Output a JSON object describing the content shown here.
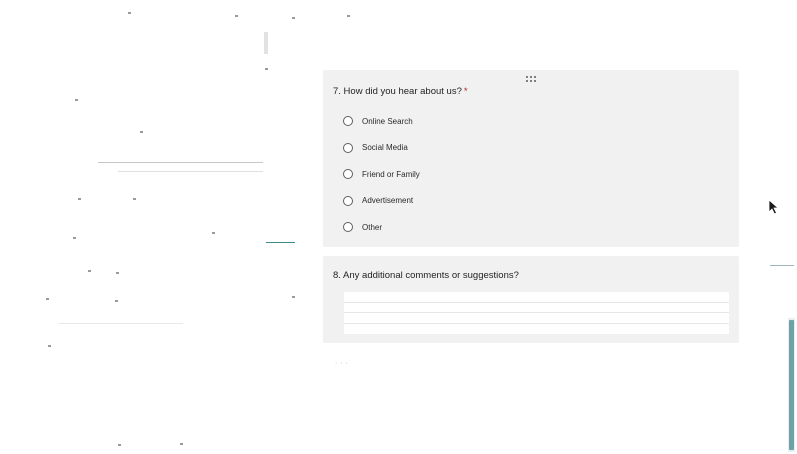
{
  "q7": {
    "number_title": "7. How did you hear about us?",
    "required_mark": "*",
    "options": [
      {
        "label": "Online Search"
      },
      {
        "label": "Social Media"
      },
      {
        "label": "Friend or Family"
      },
      {
        "label": "Advertisement"
      },
      {
        "label": "Other"
      }
    ]
  },
  "q8": {
    "number_title": "8. Any additional comments or suggestions?",
    "input_value": ""
  },
  "colors": {
    "card_background": "#f1f1f1",
    "scrollbar_thumb": "#6ea3a6",
    "required": "#a4262c"
  },
  "icons": {
    "drag_handle": "drag-handle-icon",
    "cursor": "mouse-pointer-icon"
  }
}
